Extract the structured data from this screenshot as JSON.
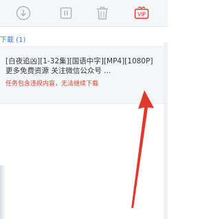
{
  "toolbar": {
    "buttons": [
      {
        "name": "download",
        "icon": "download-circle-icon"
      },
      {
        "name": "pause",
        "icon": "pause-icon"
      },
      {
        "name": "delete",
        "icon": "trash-icon"
      },
      {
        "name": "vip",
        "icon": "vip-badge-icon",
        "label": "VIP"
      }
    ]
  },
  "category": {
    "label": "下載 (1)"
  },
  "task": {
    "title": "[白夜追凶][1-32集][国语中字][MP4][1080P]更多免费资源 关注微信公众号 ...",
    "error": "任务包含违规内容，无法继续下载"
  },
  "colors": {
    "accent": "#3d7fd6",
    "error": "#e0412b",
    "annotation_arrow": "#e2382c",
    "vip": "#e5352a"
  }
}
